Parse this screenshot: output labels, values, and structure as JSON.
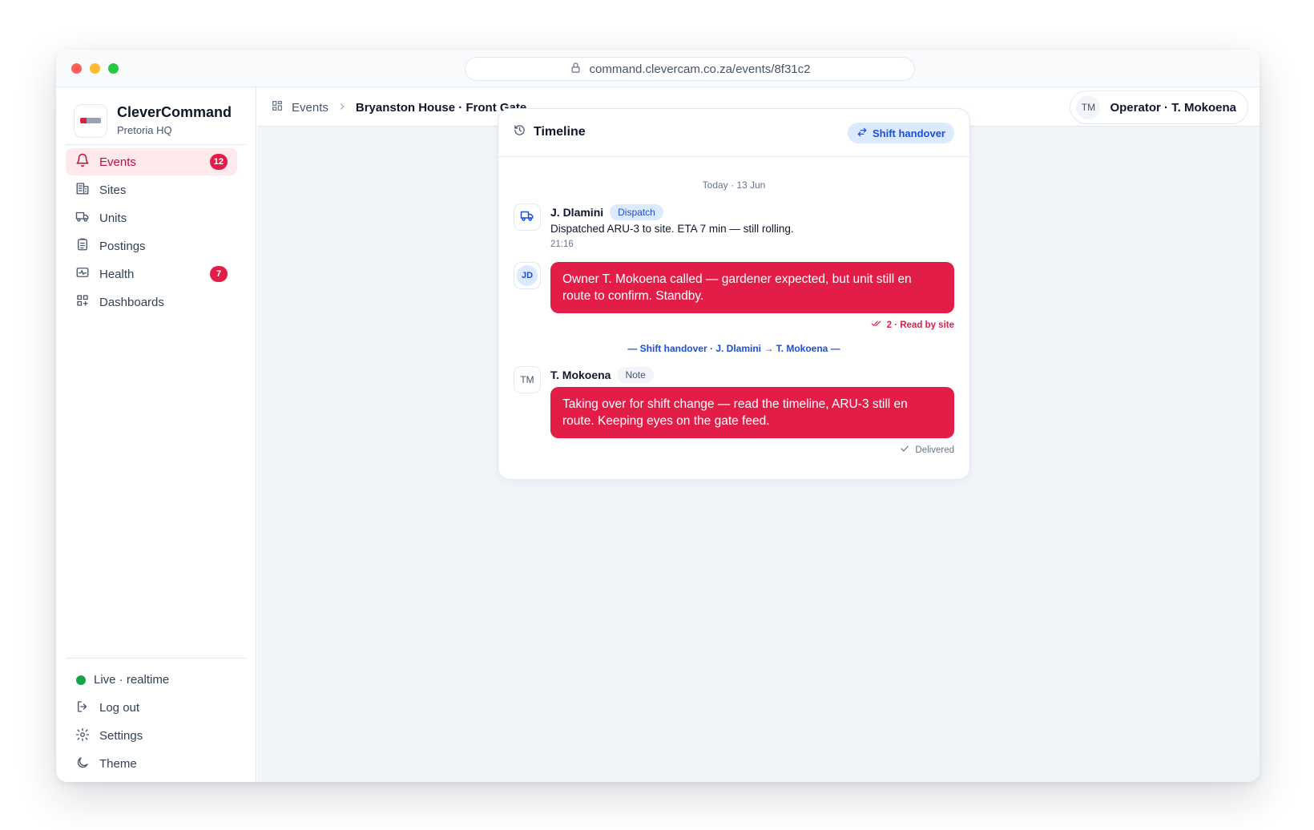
{
  "browser": {
    "url": "command.clevercam.co.za/events/8f31c2"
  },
  "sidebar": {
    "brand_name": "CleverCommand",
    "brand_sub": "Pretoria HQ",
    "items": [
      {
        "label": "Events",
        "badge": "12",
        "icon": "bell-icon",
        "active": true
      },
      {
        "label": "Sites",
        "icon": "building-icon"
      },
      {
        "label": "Units",
        "icon": "truck-icon"
      },
      {
        "label": "Postings",
        "icon": "clipboard-icon"
      },
      {
        "label": "Health",
        "badge": "7",
        "icon": "activity-icon"
      },
      {
        "label": "Dashboards",
        "icon": "dashboard-icon"
      }
    ],
    "bottom": {
      "live_label": "Live · realtime",
      "logout_label": "Log out",
      "settings_label": "Settings",
      "theme_label": "Theme"
    }
  },
  "header": {
    "breadcrumb_root": "Events",
    "breadcrumb_current": "Bryanston House · Front Gate",
    "operator_initials": "TM",
    "operator_label": "Operator · T. Mokoena"
  },
  "timeline": {
    "title": "Timeline",
    "handover_button": "Shift handover",
    "date_separator": "Today · 13 Jun",
    "entries": [
      {
        "author": "J. Dlamini",
        "tag": "Dispatch",
        "text": "Dispatched ARU-3 to site. ETA 7 min — still rolling.",
        "time": "21:16"
      },
      {
        "avatar_initials": "JD",
        "message": "Owner T. Mokoena called — gardener expected, but unit still en route to confirm. Standby.",
        "receipt": "2 · Read by site"
      },
      {
        "avatar_initials": "TM",
        "author": "T. Mokoena",
        "tag": "Note",
        "message": "Taking over for shift change — read the timeline, ARU-3 still en route. Keeping eyes on the gate feed.",
        "receipt": "Delivered"
      }
    ],
    "handover_separator": "— Shift handover · J. Dlamini → T. Mokoena —"
  },
  "colors": {
    "accent": "#e11d48",
    "accent_soft": "#fde8ec",
    "info": "#1d4ed8",
    "info_soft": "#dbeafe",
    "live": "#16a34a"
  }
}
